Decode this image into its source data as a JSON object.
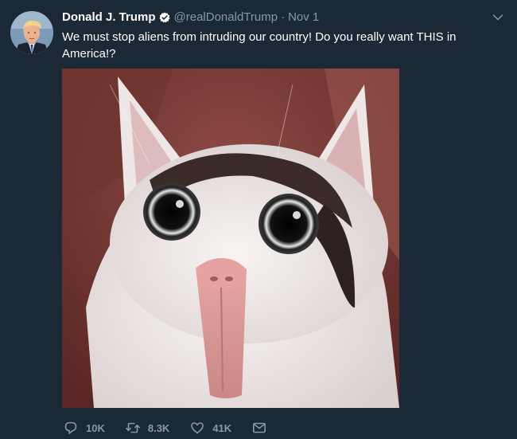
{
  "tweet": {
    "author_name": "Donald J. Trump",
    "handle": "@realDonaldTrump",
    "separator": "·",
    "date": "Nov 1",
    "text": "We must stop aliens from intruding our country! Do you really want THIS in America!?"
  },
  "actions": {
    "reply_count": "10K",
    "retweet_count": "8.3K",
    "like_count": "41K"
  },
  "icons": {
    "verified": "verified-badge-icon",
    "caret": "chevron-down-icon",
    "reply": "reply-icon",
    "retweet": "retweet-icon",
    "like": "heart-icon",
    "message": "envelope-icon"
  },
  "colors": {
    "background": "#1b2836",
    "secondary_text": "#8899a6",
    "primary_text": "#ffffff"
  }
}
